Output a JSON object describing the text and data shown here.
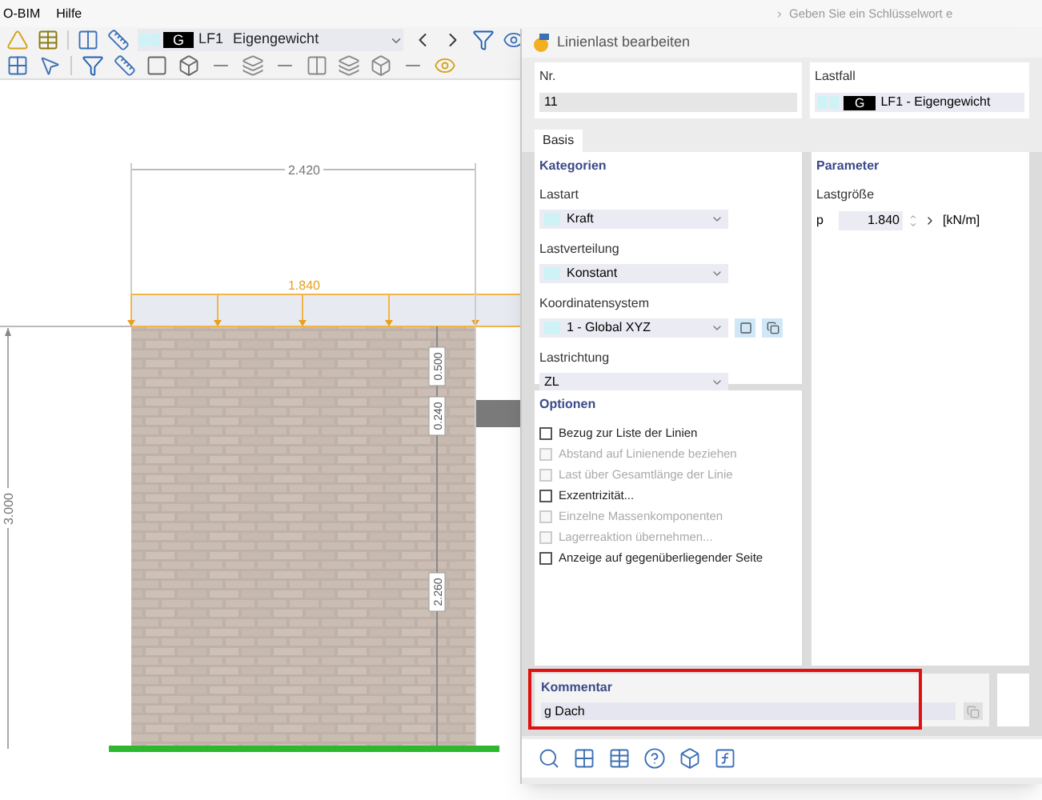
{
  "menu": [
    "O-BIM",
    "Hilfe"
  ],
  "search": {
    "placeholder": "Geben Sie ein Schlüsselwort e"
  },
  "load_case_selector": {
    "badge": "G",
    "code": "LF1",
    "name": "Eigengewicht"
  },
  "drawing": {
    "width_dimension": "2.420",
    "load_value": "1.840",
    "height_dimension": "3.000",
    "wall_dimensions": [
      {
        "label": "0.500"
      },
      {
        "label": "0.240"
      },
      {
        "label": "2.260"
      }
    ]
  },
  "dialog": {
    "title": "Linienlast bearbeiten",
    "number": {
      "label": "Nr.",
      "value": "11"
    },
    "load_case": {
      "label": "Lastfall",
      "badge": "G",
      "value": "LF1 - Eigengewicht"
    },
    "tabs": [
      {
        "label": "Basis",
        "selected": true
      }
    ],
    "categories": {
      "title": "Kategorien",
      "fields": [
        {
          "label": "Lastart",
          "value": "Kraft",
          "swatch": true,
          "kind": "select"
        },
        {
          "label": "Lastverteilung",
          "value": "Konstant",
          "swatch": true,
          "kind": "select"
        },
        {
          "label": "Koordinatensystem",
          "value": "1 - Global XYZ",
          "swatch": true,
          "kind": "select_with_buttons"
        },
        {
          "label": "Lastrichtung",
          "value": "ZL",
          "swatch": false,
          "kind": "select"
        }
      ]
    },
    "parameters": {
      "title": "Parameter",
      "label": "Lastgröße",
      "symbol": "p",
      "value": "1.840",
      "unit": "[kN/m]"
    },
    "options": {
      "title": "Optionen",
      "items": [
        {
          "label": "Bezug zur Liste der Linien",
          "checked": false,
          "disabled": false
        },
        {
          "label": "Abstand auf Linienende beziehen",
          "checked": false,
          "disabled": true
        },
        {
          "label": "Last über Gesamtlänge der Linie",
          "checked": false,
          "disabled": true
        },
        {
          "label": "Exzentrizität...",
          "checked": false,
          "disabled": false
        },
        {
          "label": "Einzelne Massenkomponenten",
          "checked": false,
          "disabled": true
        },
        {
          "label": "Lagerreaktion übernehmen...",
          "checked": false,
          "disabled": true
        },
        {
          "label": "Anzeige auf gegenüberliegender Seite",
          "checked": false,
          "disabled": false
        }
      ]
    },
    "comment": {
      "label": "Kommentar",
      "value": "g Dach",
      "highlighted": true
    }
  }
}
